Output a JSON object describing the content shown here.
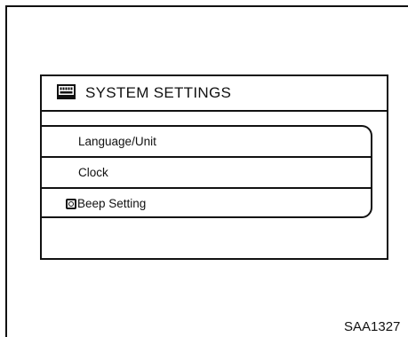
{
  "screen": {
    "title": "SYSTEM SETTINGS",
    "title_icon": "system-settings-icon"
  },
  "menu": {
    "items": [
      {
        "label": "Language/Unit",
        "selected": false
      },
      {
        "label": "Clock",
        "selected": false
      },
      {
        "label": "Beep Setting",
        "selected": true,
        "indicator_icon": "radio-on-icon"
      }
    ]
  },
  "figure": {
    "code": "SAA1327"
  }
}
